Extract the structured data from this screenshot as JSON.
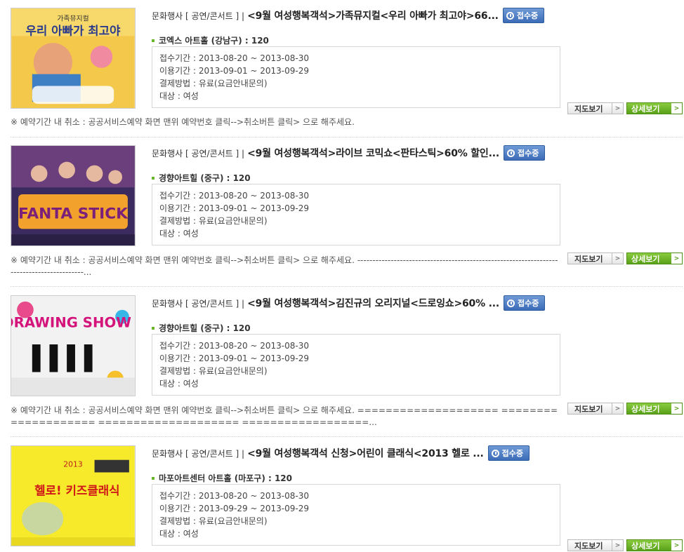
{
  "status_label": "접수중",
  "labels": {
    "apply_period": "접수기간",
    "use_period": "이용기간",
    "payment": "결제방법",
    "target": "대상",
    "sep": " : "
  },
  "buttons": {
    "map": "지도보기",
    "detail": "상세보기"
  },
  "colors": {
    "badge": "#3c6cb7",
    "detail_button": "#59a11a",
    "bullet": "#6bb52b"
  },
  "events": [
    {
      "category": "문화행사 [ 공연/콘서트 ] |",
      "title": "<9월 여성행복객석>가족뮤지컬<우리 아빠가 최고야>66...",
      "venue": "코엑스 아트홀 (강남구) : 120",
      "apply": "2013-08-20 ~ 2013-08-30",
      "use": "2013-09-01 ~ 2013-09-29",
      "payment": "유료(요금안내문의)",
      "target": "여성",
      "notice": "※ 예약기간 내 취소 : 공공서비스예약 화면 맨위 예약번호 클릭-->취소버튼 클릭> 으로 해주세요.",
      "poster": {
        "text_top": "가족뮤지컬",
        "text_main": "우리 아빠가 최고야",
        "bg": "#f4c84a"
      }
    },
    {
      "category": "문화행사 [ 공연/콘서트 ] |",
      "title": "<9월 여성행복객석>라이브 코믹쇼<판타스틱>60% 할인...",
      "venue": "경향아트힐 (중구) : 120",
      "apply": "2013-08-20 ~ 2013-08-30",
      "use": "2013-09-01 ~ 2013-09-29",
      "payment": "유료(요금안내문의)",
      "target": "여성",
      "notice": "※ 예약기간 내 취소 : 공공서비스예약 화면 맨위 예약번호 클릭-->취소버튼 클릭> 으로 해주세요. ------------------------------------------------------------------------------------------...",
      "poster": {
        "text_top": "",
        "text_main": "FANTA STICK",
        "bg": "#3b2a5e"
      }
    },
    {
      "category": "문화행사 [ 공연/콘서트 ] |",
      "title": "<9월 여성행복객석>김진규의 오리지널<드로잉쇼>60% ...",
      "venue": "경향아트힐 (중구) : 120",
      "apply": "2013-08-20 ~ 2013-08-30",
      "use": "2013-09-01 ~ 2013-09-29",
      "payment": "유료(요금안내문의)",
      "target": "여성",
      "notice": "※ 예약기간 내 취소 : 공공서비스예약 화면 맨위 예약번호 클릭-->취소버튼 클릭> 으로 해주세요. ==================== ==================== ==================== ==================...",
      "poster": {
        "text_top": "",
        "text_main": "DRAWING SHOW",
        "bg": "#f2f2f2"
      }
    },
    {
      "category": "문화행사 [ 공연/콘서트 ] |",
      "title": "<9월 여성행복객석 신청>어린이 클래식<2013 헬로 ...",
      "venue": "마포아트센터 아트홀 (마포구) : 120",
      "apply": "2013-08-20 ~ 2013-08-30",
      "use": "2013-09-29 ~ 2013-09-29",
      "payment": "유료(요금안내문의)",
      "target": "여성",
      "notice": "",
      "poster": {
        "text_top": "2013",
        "text_main": "헬로! 키즈클래식",
        "bg": "#f6ea2a"
      }
    }
  ]
}
